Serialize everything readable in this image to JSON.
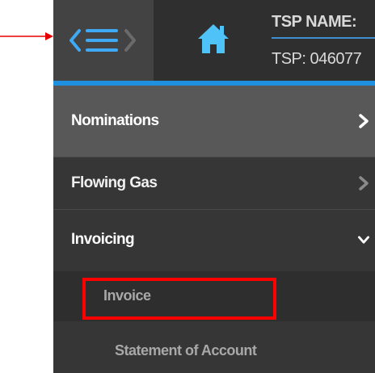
{
  "header": {
    "menu_toggle_icon": "hamburger-icon",
    "home_icon": "home-icon",
    "tsp_name_label": "TSP NAME:",
    "tsp_id_label": "TSP: 046077"
  },
  "menu": {
    "items": [
      {
        "label": "Nominations",
        "icon": "chevron-right-icon"
      },
      {
        "label": "Flowing Gas",
        "icon": "chevron-right-icon"
      },
      {
        "label": "Invoicing",
        "icon": "chevron-down-icon"
      }
    ],
    "invoicing_sub_items": [
      {
        "label": "Invoice"
      },
      {
        "label": "Statement of Account"
      }
    ]
  },
  "colors": {
    "accent": "#1f8fe0",
    "highlight": "#ff0000",
    "panel": "#363636"
  }
}
